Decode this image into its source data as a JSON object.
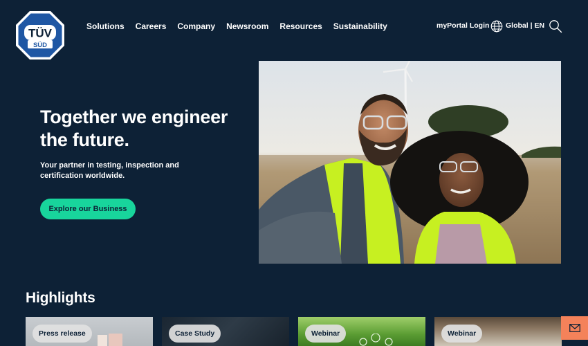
{
  "brand": {
    "logo_top": "TÜV",
    "logo_bottom": "SÜD"
  },
  "nav": {
    "items": [
      {
        "label": "Solutions"
      },
      {
        "label": "Careers"
      },
      {
        "label": "Company"
      },
      {
        "label": "Newsroom"
      },
      {
        "label": "Resources"
      },
      {
        "label": "Sustainability"
      }
    ],
    "portal_label": "myPortal Login",
    "global_label": "Global | EN"
  },
  "hero": {
    "title": "Together we engineer the future.",
    "subtitle": "Your partner in testing, inspection and certification worldwide.",
    "cta_label": "Explore our Business"
  },
  "highlights": {
    "title": "Highlights",
    "cards": [
      {
        "badge": "Press release"
      },
      {
        "badge": "Case Study"
      },
      {
        "badge": "Webinar"
      },
      {
        "badge": "Webinar"
      }
    ]
  },
  "colors": {
    "background": "#0d2136",
    "cta": "#18d59c",
    "mail_button": "#f4825a"
  },
  "icons": {
    "globe": "globe-icon",
    "search": "search-icon",
    "mail": "mail-icon"
  }
}
